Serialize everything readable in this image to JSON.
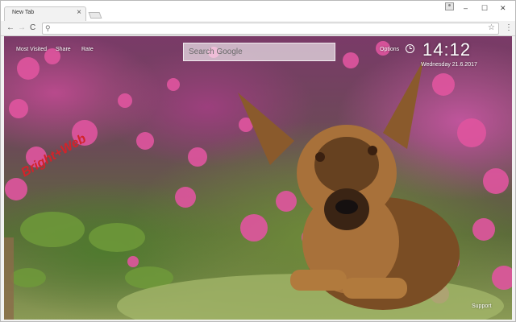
{
  "browser": {
    "tab_title": "New Tab",
    "tab_close": "×",
    "window_controls": {
      "minimize": "–",
      "maximize": "☐",
      "close": "✕"
    },
    "nav": {
      "back": "←",
      "forward": "→",
      "reload": "C"
    },
    "omnibox_icon": "⚲",
    "bookmark_icon": "☆",
    "menu_icon": "⋮"
  },
  "newtab": {
    "links": {
      "most_visited": "Most Visited",
      "share": "Share",
      "rate": "Rate",
      "options": "Options",
      "support": "Support"
    },
    "search": {
      "placeholder": "Search Google"
    },
    "clock": {
      "time": "14:12",
      "date": "Wednesday  21.6.2017"
    },
    "background": {
      "subject": "german-shepherd-dog",
      "watermark": "Bright+Web",
      "colors": {
        "flowers": "#e0559f",
        "grass": "#8aa24c",
        "fur": "#a8713a"
      }
    }
  }
}
